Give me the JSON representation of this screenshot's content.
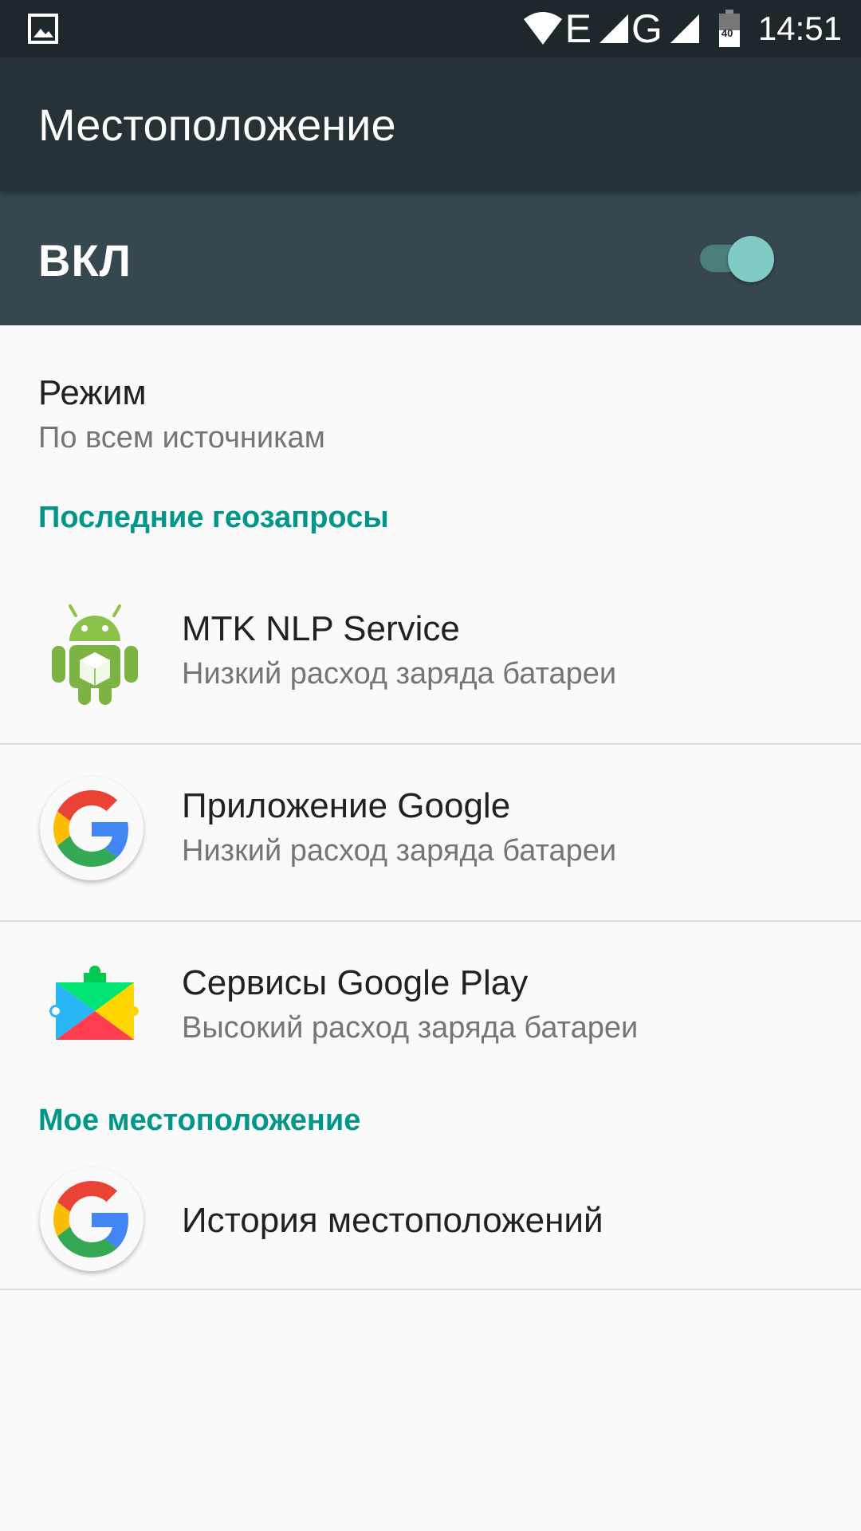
{
  "status_bar": {
    "time": "14:51",
    "network_1": "E",
    "network_2": "G",
    "battery_level": "40",
    "icons": [
      "image-icon",
      "wifi-icon",
      "signal-icon",
      "signal-icon",
      "battery-icon"
    ]
  },
  "toolbar": {
    "title": "Местоположение"
  },
  "master_switch": {
    "label": "ВКЛ",
    "checked": true,
    "accent": "#80cbc4"
  },
  "mode": {
    "title": "Режим",
    "summary": "По всем источникам"
  },
  "recent_requests": {
    "header": "Последние геозапросы",
    "items": [
      {
        "icon": "android-icon",
        "title": "MTK NLP Service",
        "summary": "Низкий расход заряда батареи"
      },
      {
        "icon": "google-g-icon",
        "title": "Приложение Google",
        "summary": "Низкий расход заряда батареи"
      },
      {
        "icon": "google-play-services-icon",
        "title": "Сервисы Google Play",
        "summary": "Высокий расход заряда батареи"
      }
    ]
  },
  "my_location": {
    "header": "Мое местоположение",
    "items": [
      {
        "icon": "google-g-icon",
        "title": "История местоположений"
      }
    ]
  },
  "colors": {
    "status_bar": "#1e272c",
    "toolbar": "#263238",
    "switch_bar": "#37474f",
    "accent": "#009688",
    "background": "#fafafa"
  }
}
